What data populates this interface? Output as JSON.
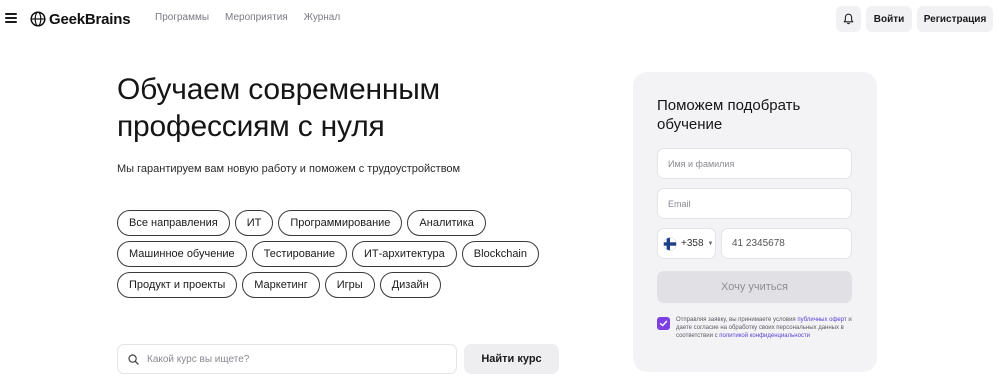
{
  "header": {
    "brand": "GeekBrains",
    "nav": [
      {
        "label": "Программы"
      },
      {
        "label": "Мероприятия"
      },
      {
        "label": "Журнал"
      }
    ],
    "login_label": "Войти",
    "register_label": "Регистрация",
    "icons": [
      "menu-icon",
      "geekbrains-logo-icon",
      "bell-icon"
    ]
  },
  "hero": {
    "title_line1": "Обучаем современным",
    "title_line2": "профессиям с нуля",
    "subtitle": "Мы гарантируем вам новую работу и поможем с трудоустройством",
    "chips": [
      [
        "Все направления",
        "ИТ",
        "Программирование",
        "Аналитика"
      ],
      [
        "Машинное обучение",
        "Тестирование",
        "ИТ-архитектура",
        "Blockchain"
      ],
      [
        "Продукт и проекты",
        "Маркетинг",
        "Игры",
        "Дизайн"
      ]
    ]
  },
  "search": {
    "placeholder": "Какой курс вы ищете?",
    "button_label": "Найти курс",
    "icon": "search-icon"
  },
  "form": {
    "title": "Поможем подобрать обучение",
    "name_placeholder": "Имя и фамилия",
    "email_placeholder": "Email",
    "phone_code": "+358",
    "phone_flag": "finland-flag-icon",
    "phone_placeholder": "41 2345678",
    "submit_label": "Хочу учиться",
    "consent": {
      "checked": true,
      "part1": "Отправляя заявку, вы принимаете условия ",
      "link1": "публичных оферт",
      "part2": " и даете согласие на обработку своих персональных данных в соответствии с ",
      "link2": "политикой конфиденциальности"
    }
  },
  "colors": {
    "accent": "#7b3fe4",
    "card_bg": "#f3f3f6",
    "button_bg": "#f1f1f4",
    "link": "#5a3fd0"
  }
}
